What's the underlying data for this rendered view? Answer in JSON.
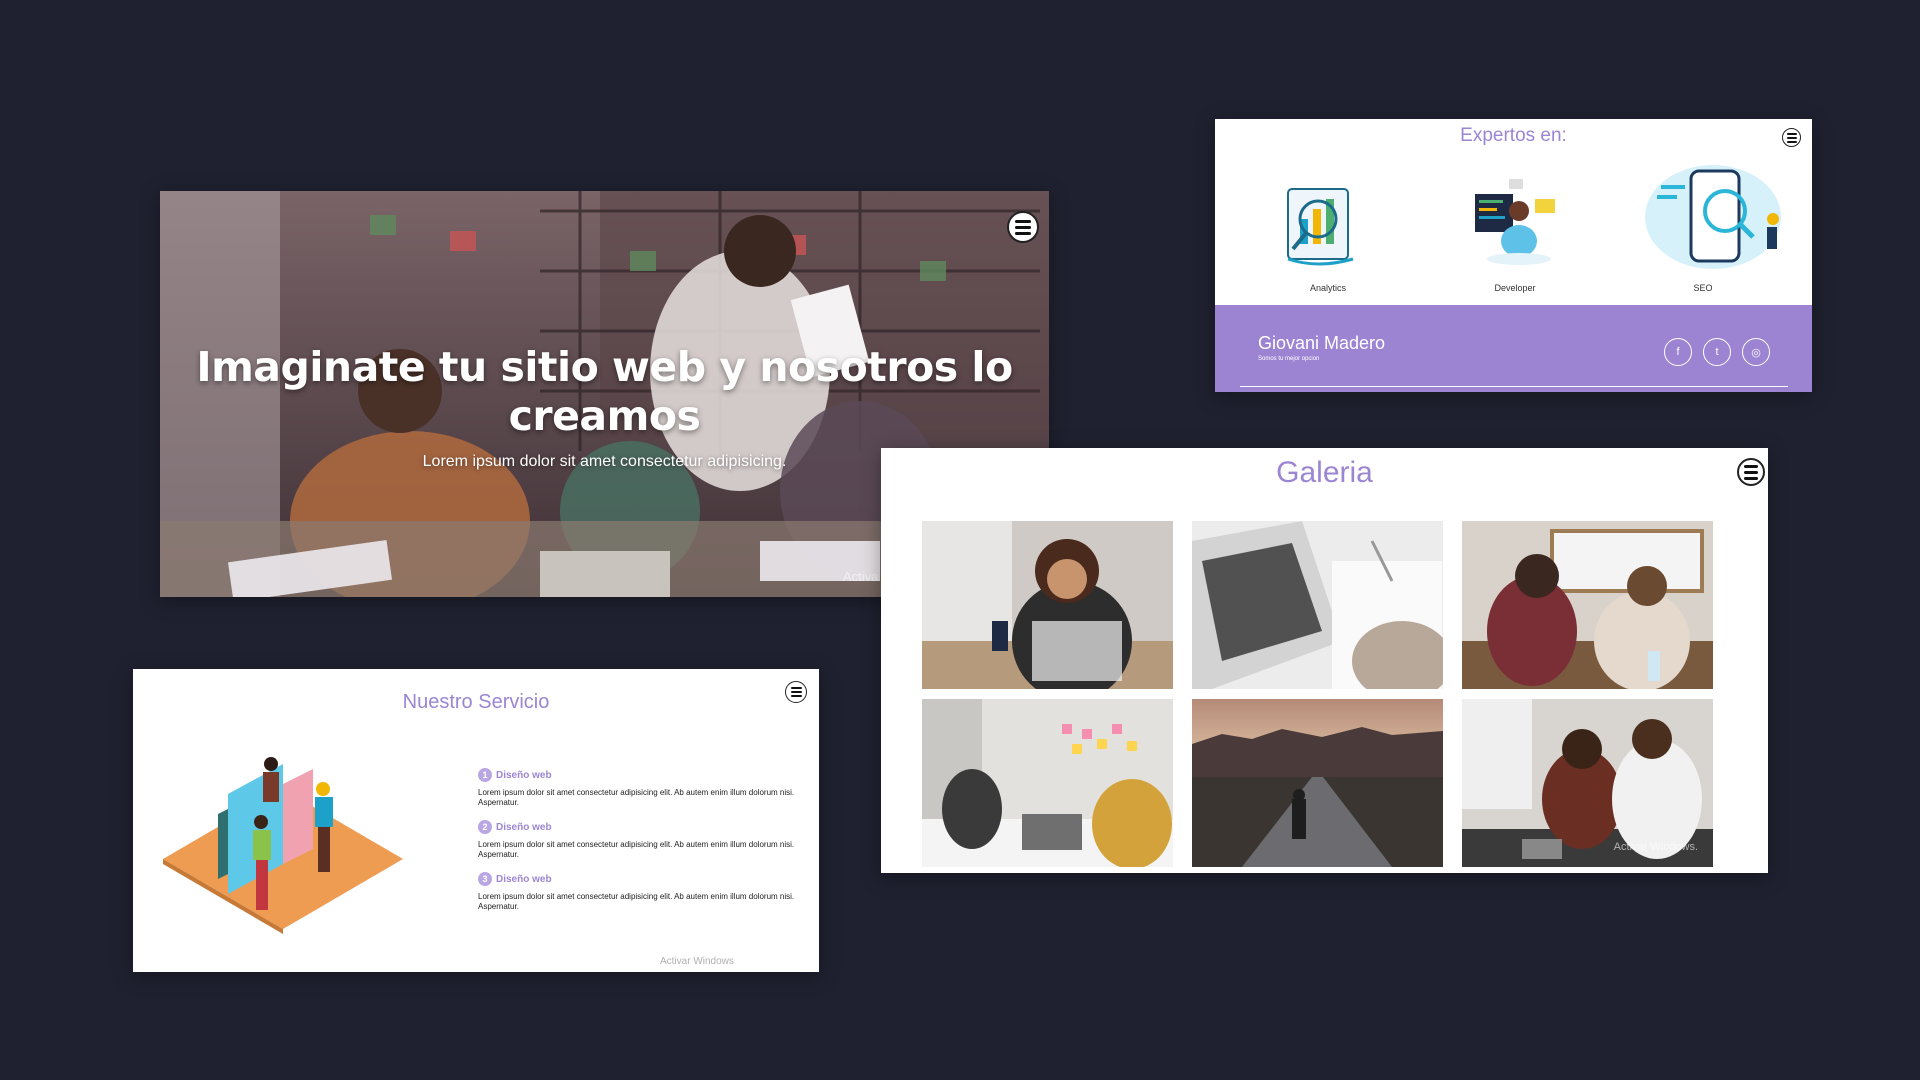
{
  "hero": {
    "title": "Imaginate tu sitio web y nosotros lo creamos",
    "subtitle": "Lorem ipsum dolor sit amet consectetur adipisicing.",
    "watermark": "Activa"
  },
  "expertos": {
    "title": "Expertos en:",
    "items": [
      {
        "label": "Analytics",
        "icon": "analytics-icon"
      },
      {
        "label": "Developer",
        "icon": "developer-icon"
      },
      {
        "label": "SEO",
        "icon": "seo-icon"
      }
    ],
    "footer": {
      "name": "Giovani Madero",
      "tagline": "Somos tu mejor opcion",
      "social": [
        {
          "icon": "facebook-icon",
          "glyph": "f"
        },
        {
          "icon": "twitter-icon",
          "glyph": "t"
        },
        {
          "icon": "instagram-icon",
          "glyph": "◎"
        }
      ]
    }
  },
  "galeria": {
    "title": "Galeria",
    "watermark": "Activar Windows."
  },
  "servicio": {
    "title": "Nuestro Servicio",
    "items": [
      {
        "num": "1",
        "title": "Diseño web",
        "text": "Lorem ipsum dolor sit amet consectetur adipisicing elit. Ab autem enim illum dolorum nisi. Aspernatur."
      },
      {
        "num": "2",
        "title": "Diseño web",
        "text": "Lorem ipsum dolor sit amet consectetur adipisicing elit. Ab autem enim illum dolorum nisi. Aspernatur."
      },
      {
        "num": "3",
        "title": "Diseño web",
        "text": "Lorem ipsum dolor sit amet consectetur adipisicing elit. Ab autem enim illum dolorum nisi. Aspernatur."
      }
    ],
    "watermark": "Activar Windows"
  },
  "colors": {
    "background": "#1f2130",
    "accent": "#9d84d3"
  }
}
